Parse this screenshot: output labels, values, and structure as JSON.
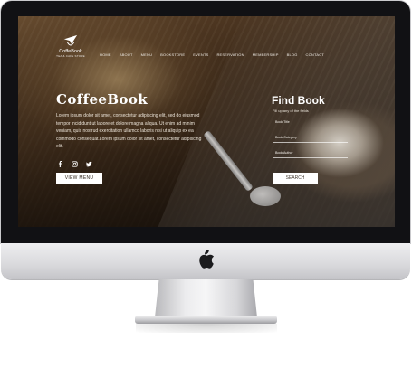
{
  "site": {
    "logo": {
      "name": "CoffeBook",
      "tagline": "TEA & CAFE STORE"
    },
    "nav": [
      "HOME",
      "ABOUT",
      "MENU",
      "BOOKSTORE",
      "EVENTS",
      "RESERVATION",
      "MEMBERSHIP",
      "BLOG",
      "CONTACT"
    ]
  },
  "hero": {
    "title": "CoffeeBook",
    "text": "Lorem ipsum dolor sit amet, consectetur adipiscing elit, sed do eiusmod tempor incididunt ut labore et dolore magna aliqua. Ut enim ad minim veniam, quis nostrud exercitation ullamco laboris nisi ut aliquip ex ea commodo consequat.Lorem ipsum dolor sit amet, consectetur adipiscing elit.",
    "social_icons": [
      "facebook-icon",
      "instagram-icon",
      "twitter-icon"
    ],
    "button": "VIEW MENU"
  },
  "find": {
    "title": "Find Book",
    "subtitle": "Fill up any of the fields",
    "fields": [
      "Book Title",
      "Book Category",
      "Book Author"
    ],
    "button": "SEARCH"
  },
  "colors": {
    "screen_bg": "#3a2a1c",
    "button_bg": "#ffffff",
    "text_light": "#ffffff"
  }
}
